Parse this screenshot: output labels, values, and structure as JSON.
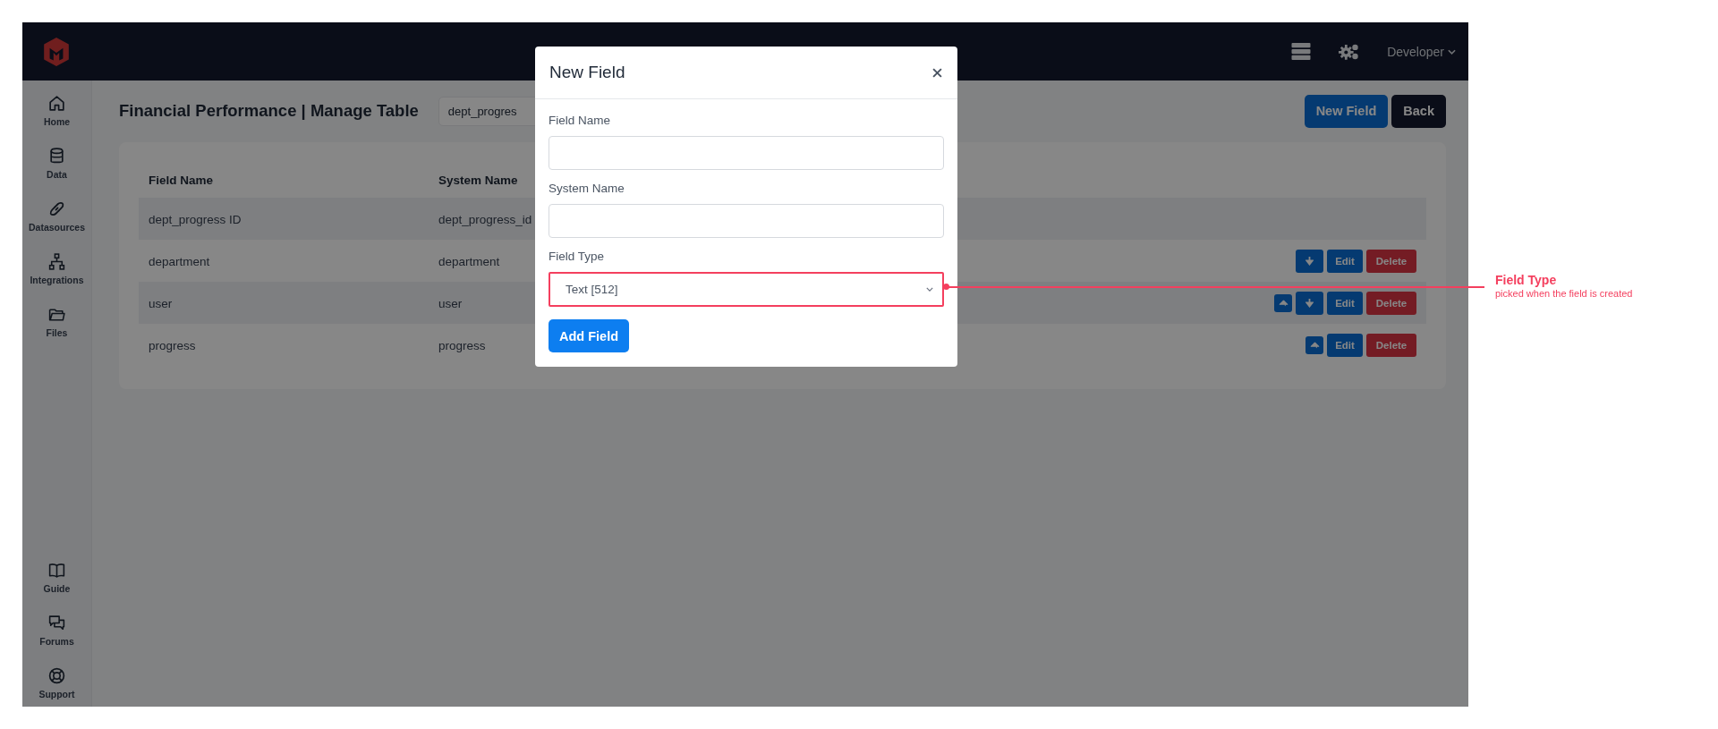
{
  "header": {
    "user_menu": "Developer"
  },
  "sidebar": {
    "main_items": [
      {
        "label": "Home"
      },
      {
        "label": "Data"
      },
      {
        "label": "Datasources"
      },
      {
        "label": "Integrations"
      },
      {
        "label": "Files"
      }
    ],
    "bottom_items": [
      {
        "label": "Guide"
      },
      {
        "label": "Forums"
      },
      {
        "label": "Support"
      }
    ]
  },
  "page": {
    "title": "Financial Performance | Manage Table",
    "table_select": "dept_progres",
    "buttons": [
      {
        "label": "New Field",
        "kind": "primary"
      },
      {
        "label": "Back",
        "kind": "dark"
      }
    ]
  },
  "table": {
    "columns": [
      "Field Name",
      "System Name"
    ],
    "rows": [
      {
        "cells": [
          "dept_progress ID",
          "dept_progress_id"
        ],
        "actions": []
      },
      {
        "cells": [
          "department",
          "department"
        ],
        "actions": [
          {
            "kind": "move-down"
          },
          {
            "kind": "edit",
            "label": "Edit"
          },
          {
            "kind": "delete",
            "label": "Delete"
          }
        ]
      },
      {
        "cells": [
          "user",
          "user"
        ],
        "actions": [
          {
            "kind": "move-up"
          },
          {
            "kind": "move-down"
          },
          {
            "kind": "edit",
            "label": "Edit"
          },
          {
            "kind": "delete",
            "label": "Delete"
          }
        ]
      },
      {
        "cells": [
          "progress",
          "progress"
        ],
        "actions": [
          {
            "kind": "move-up"
          },
          {
            "kind": "edit",
            "label": "Edit"
          },
          {
            "kind": "delete",
            "label": "Delete"
          }
        ]
      }
    ]
  },
  "modal": {
    "title": "New Field",
    "fields": [
      {
        "label": "Field Name",
        "kind": "text"
      },
      {
        "label": "System Name",
        "kind": "text"
      },
      {
        "label": "Field Type",
        "kind": "select",
        "value": "Text [512]",
        "highlighted": true
      }
    ],
    "submit": "Add Field"
  },
  "annotation": {
    "title": "Field Type",
    "note": "picked when the field is created"
  }
}
